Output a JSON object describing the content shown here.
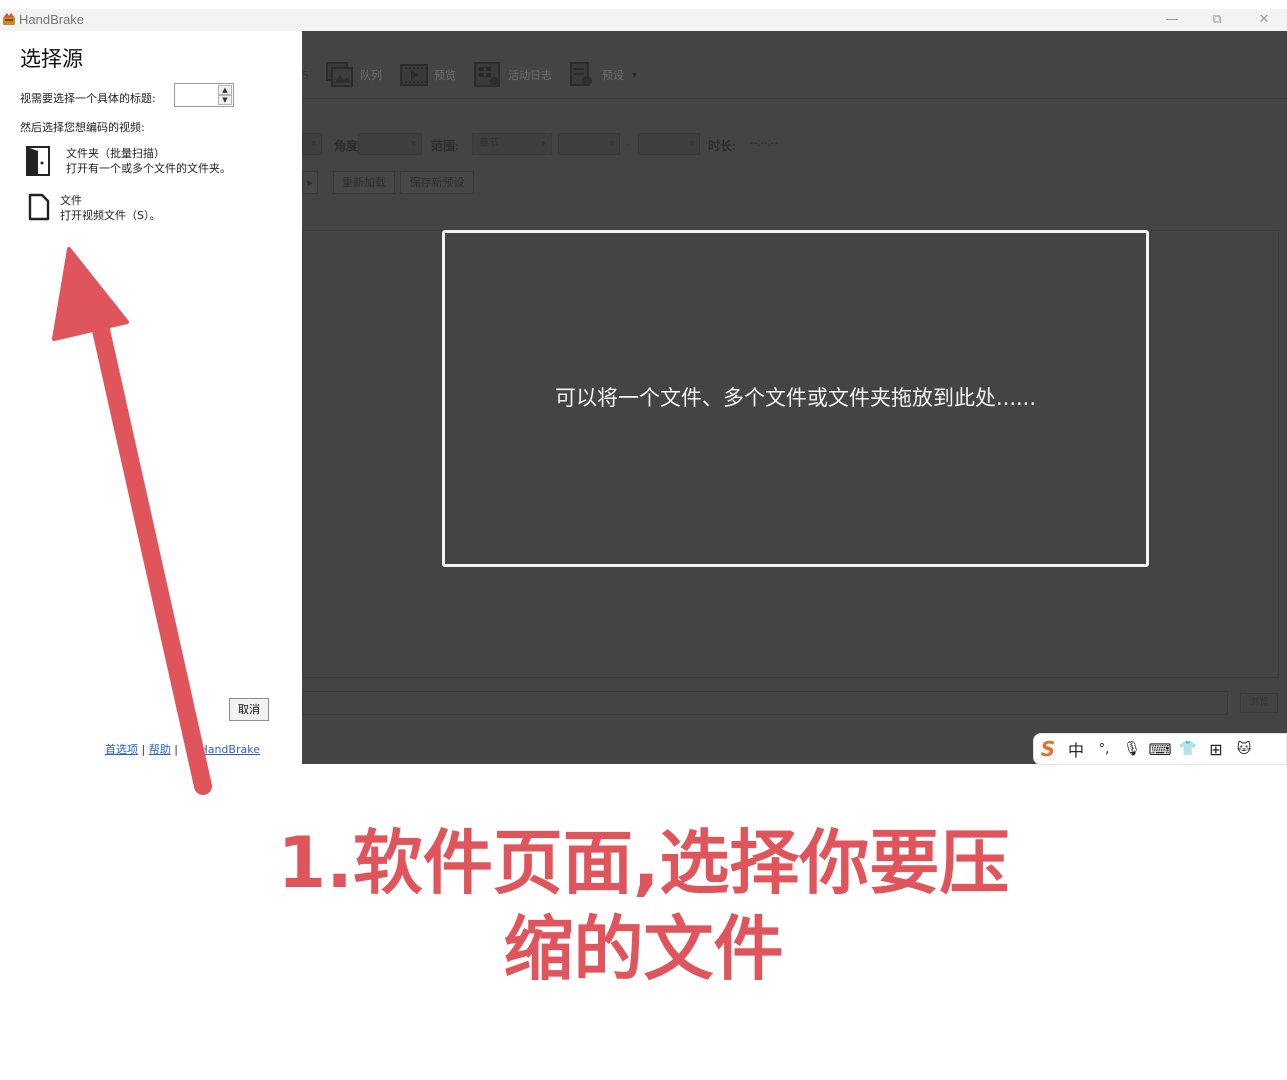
{
  "window": {
    "app_title": "HandBrake",
    "minimize": "—",
    "restore": "⧉",
    "close": "✕"
  },
  "toolbar": {
    "partial_left": "5",
    "queue": "队列",
    "preview": "预览",
    "activity_log": "活动日志",
    "presets": "预设",
    "presets_caret": "▾"
  },
  "options": {
    "angle_label": "角度",
    "range_label": "范围:",
    "range_value": "章节",
    "range_sep": "-",
    "duration_label": "时长:",
    "duration_value": "--:--:--",
    "play_glyph": "▸",
    "reload_button": "重新加载",
    "save_preset_button": "保存新预设"
  },
  "drop_zone": {
    "text": "可以将一个文件、多个文件或文件夹拖放到此处......"
  },
  "destination": {
    "browse": "浏览"
  },
  "source_panel": {
    "title": "选择源",
    "title_select_label": "视需要选择一个具体的标题:",
    "then_label": "然后选择您想编码的视频:",
    "folder_title": "文件夹（批量扫描）",
    "folder_desc": "打开有一个或多个文件的文件夹。",
    "file_title": "文件",
    "file_desc": "打开视频文件（S）。",
    "cancel": "取消",
    "link_preferences": "首选项",
    "link_help": "帮助",
    "link_sep": "|",
    "link_about_visible": "HandBrake"
  },
  "ime_toolbar": {
    "logo": "S",
    "lang": "中",
    "punct": "°,",
    "mic_glyph": "🎙",
    "keyboard_glyph": "⌨",
    "shirt_glyph": "👕",
    "apps_glyph": "⊞",
    "mascot_glyph": "🐱"
  },
  "caption": {
    "line1": "1.软件页面,选择你要压",
    "line2": "缩的文件"
  },
  "colors": {
    "dark_bg": "#444444",
    "accent_red": "#e0545c",
    "link_blue": "#2b5fc7"
  }
}
